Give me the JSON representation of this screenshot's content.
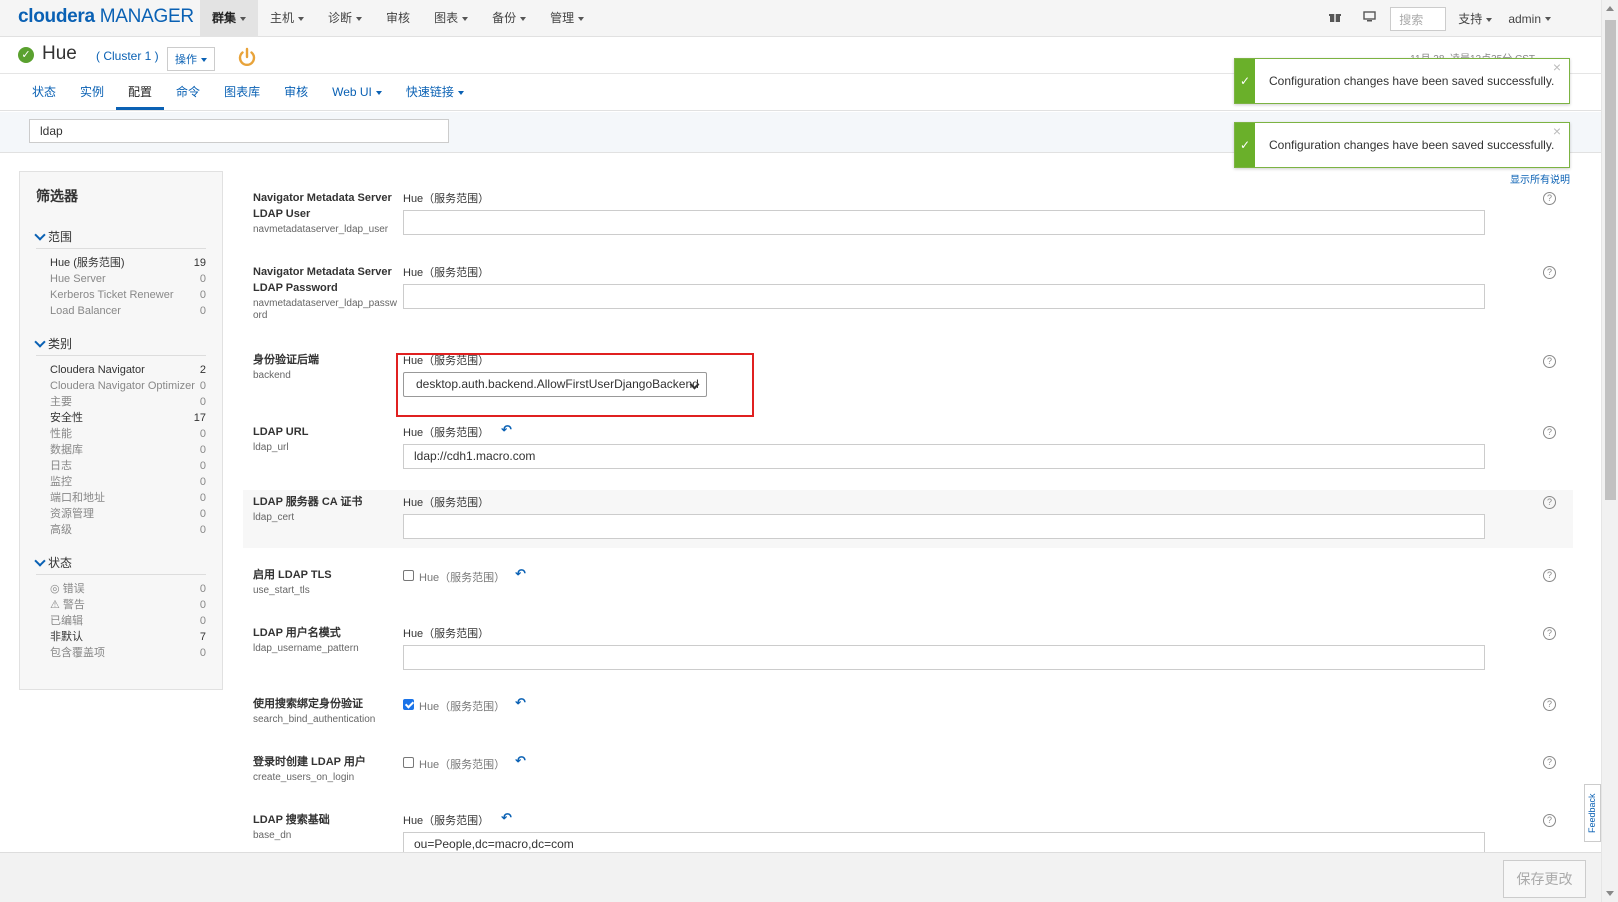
{
  "brand": {
    "part1": "cloudera",
    "part2": " MANAGER"
  },
  "nav": {
    "items": [
      {
        "label": "群集",
        "active": true
      },
      {
        "label": "主机"
      },
      {
        "label": "诊断"
      },
      {
        "label": "审核"
      },
      {
        "label": "图表"
      },
      {
        "label": "备份"
      },
      {
        "label": "管理"
      }
    ],
    "search_placeholder": "搜索",
    "support": "支持",
    "user": "admin",
    "icons": [
      "gift-icon",
      "monitor-icon"
    ]
  },
  "service": {
    "name": "Hue",
    "cluster": "( Cluster 1 )",
    "actions": "操作",
    "status_icon": "check-circle-icon",
    "timestamp": "11月 28, 凌晨12点35分 CST"
  },
  "tabs": [
    {
      "label": "状态"
    },
    {
      "label": "实例"
    },
    {
      "label": "配置",
      "active": true
    },
    {
      "label": "命令"
    },
    {
      "label": "图表库"
    },
    {
      "label": "审核"
    },
    {
      "label": "Web UI"
    },
    {
      "label": "快速链接"
    }
  ],
  "filter": {
    "value": "ldap"
  },
  "toasts": [
    {
      "message": "Configuration changes have been saved successfully."
    },
    {
      "message": "Configuration changes have been saved successfully."
    }
  ],
  "show_all": "显示所有说明",
  "sidebar": {
    "title": "筛选器",
    "sections": [
      {
        "title": "范围",
        "items": [
          {
            "label": "Hue (服务范围)",
            "count": "19",
            "on": true
          },
          {
            "label": "Hue Server",
            "count": "0"
          },
          {
            "label": "Kerberos Ticket Renewer",
            "count": "0"
          },
          {
            "label": "Load Balancer",
            "count": "0"
          }
        ]
      },
      {
        "title": "类别",
        "items": [
          {
            "label": "Cloudera Navigator",
            "count": "2",
            "on": true
          },
          {
            "label": "Cloudera Navigator Optimizer",
            "count": "0"
          },
          {
            "label": "主要",
            "count": "0"
          },
          {
            "label": "安全性",
            "count": "17",
            "on": true
          },
          {
            "label": "性能",
            "count": "0"
          },
          {
            "label": "数据库",
            "count": "0"
          },
          {
            "label": "日志",
            "count": "0"
          },
          {
            "label": "监控",
            "count": "0"
          },
          {
            "label": "端口和地址",
            "count": "0"
          },
          {
            "label": "资源管理",
            "count": "0"
          },
          {
            "label": "高级",
            "count": "0"
          }
        ]
      },
      {
        "title": "状态",
        "items": [
          {
            "label": "◎ 错误",
            "count": "0"
          },
          {
            "label": "⚠ 警告",
            "count": "0"
          },
          {
            "label": "已编辑",
            "count": "0"
          },
          {
            "label": "非默认",
            "count": "7",
            "on": true
          },
          {
            "label": "包含覆盖项",
            "count": "0"
          }
        ]
      }
    ]
  },
  "config": {
    "scope": "Hue（服务范围）",
    "rows": [
      {
        "label1": "Navigator Metadata Server",
        "label2": "LDAP User",
        "key": "navmetadataserver_ldap_user",
        "type": "text",
        "value": ""
      },
      {
        "label1": "Navigator Metadata Server",
        "label2": "LDAP Password",
        "key": "navmetadataserver_ldap_passw",
        "key2": "ord",
        "type": "text",
        "value": ""
      },
      {
        "label1": "身份验证后端",
        "key": "backend",
        "type": "select",
        "value": "desktop.auth.backend.AllowFirstUserDjangoBackend"
      },
      {
        "label1": "LDAP URL",
        "key": "ldap_url",
        "type": "text",
        "value": "ldap://cdh1.macro.com",
        "undo": true
      },
      {
        "label1": "LDAP 服务器 CA 证书",
        "key": "ldap_cert",
        "type": "text",
        "value": ""
      },
      {
        "label1": "启用 LDAP TLS",
        "key": "use_start_tls",
        "type": "checkbox",
        "checked": false,
        "undo": true
      },
      {
        "label1": "LDAP 用户名模式",
        "key": "ldap_username_pattern",
        "type": "text",
        "value": ""
      },
      {
        "label1": "使用搜索绑定身份验证",
        "key": "search_bind_authentication",
        "type": "checkbox",
        "checked": true,
        "undo": true
      },
      {
        "label1": "登录时创建 LDAP 用户",
        "key": "create_users_on_login",
        "type": "checkbox",
        "checked": false,
        "undo": true
      },
      {
        "label1": "LDAP 搜索基础",
        "key": "base_dn",
        "type": "text",
        "value": "ou=People,dc=macro,dc=com",
        "undo": true
      }
    ]
  },
  "footer": {
    "save": "保存更改",
    "feedback": "Feedback"
  },
  "colors": {
    "accent": "#0a61b4",
    "success": "#6ab02a",
    "highlight": "#e02020"
  }
}
